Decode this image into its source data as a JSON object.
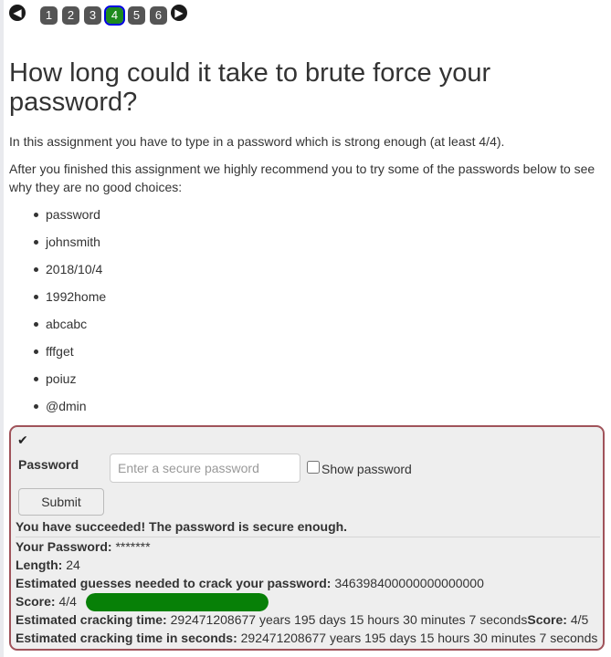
{
  "nav": {
    "prev_icon": "arrow-left-icon",
    "next_icon": "arrow-right-icon",
    "pages": [
      "1",
      "2",
      "3",
      "4",
      "5",
      "6"
    ],
    "active_page": "4"
  },
  "heading": "How long could it take to brute force your password?",
  "intro": "In this assignment you have to type in a password which is strong enough (at least 4/4).",
  "advice": "After you finished this assignment we highly recommend you to try some of the passwords below to see why they are no good choices:",
  "examples": [
    "password",
    "johnsmith",
    "2018/10/4",
    "1992home",
    "abcabc",
    "fffget",
    "poiuz",
    "@dmin"
  ],
  "form": {
    "check_icon": "checkmark-icon",
    "password_label": "Password",
    "password_placeholder": "Enter a secure password",
    "show_password_label": "Show password",
    "submit_label": "Submit"
  },
  "result": {
    "success_message": "You have succeeded! The password is secure enough.",
    "your_password_label": "Your Password:",
    "your_password_value": "*******",
    "length_label": "Length:",
    "length_value": "24",
    "guesses_label": "Estimated guesses needed to crack your password:",
    "guesses_value": "346398400000000000000",
    "score_label": "Score:",
    "score_value": "4/4",
    "score_fraction": 1.0,
    "score_color": "#078007",
    "cracking_time_label": "Estimated cracking time:",
    "cracking_time_value": "292471208677 years 195 days 15 hours 30 minutes 7 seconds",
    "cracking_score_label": "Score:",
    "cracking_score_value": "4/5",
    "cracking_seconds_label": "Estimated cracking time in seconds:",
    "cracking_seconds_value": "292471208677 years 195 days 15 hours 30 minutes 7 seconds"
  }
}
